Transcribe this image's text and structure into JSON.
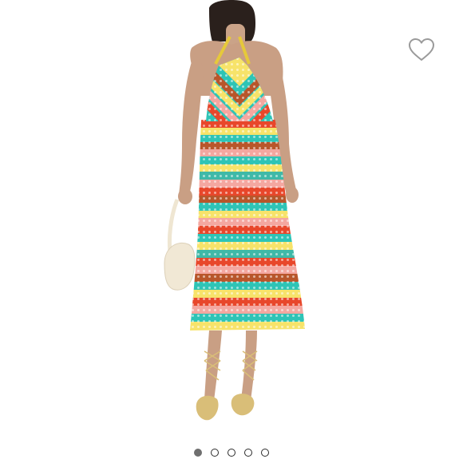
{
  "product_gallery": {
    "image": {
      "subject": "model-wearing-striped-crochet-halter-midi-dress",
      "dress_stripe_colors": [
        "#2ec4b6",
        "#f7e36a",
        "#e8472b",
        "#f4a7a0",
        "#b8562b",
        "#3fb9a8"
      ],
      "accessory": "cream-shoulder-bag",
      "footwear": "gold-strappy-sandals"
    },
    "wishlist": {
      "icon": "heart-outline-icon",
      "color": "#9a9a9a"
    },
    "carousel": {
      "total": 5,
      "current": 1
    }
  },
  "colors": {
    "background": "#ffffff",
    "dot_active": "#6f6f6f",
    "dot_border": "#2b2b2b"
  }
}
